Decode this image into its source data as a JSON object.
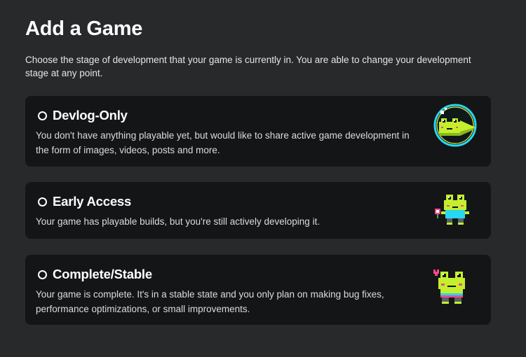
{
  "page": {
    "title": "Add a Game",
    "description": "Choose the stage of development that your game is currently in. You are able to change your development stage at any point."
  },
  "options": [
    {
      "title": "Devlog-Only",
      "description": "You don't have anything playable yet, but would like to share active game development in the form of images, videos, posts and more.",
      "illustration": "frog-in-bubble-icon"
    },
    {
      "title": "Early Access",
      "description": "Your game has playable builds, but you're still actively developing it.",
      "illustration": "frog-with-flower-icon"
    },
    {
      "title": "Complete/Stable",
      "description": "Your game is complete. It's in a stable state and you only plan on making bug fixes, performance optimizations, or small improvements.",
      "illustration": "frog-with-heart-icon"
    }
  ],
  "colors": {
    "background": "#27292b",
    "card": "#141516",
    "frog_green": "#c3ef2d",
    "frog_cyan": "#27d8f0",
    "accent_pink": "#f04a8c"
  }
}
